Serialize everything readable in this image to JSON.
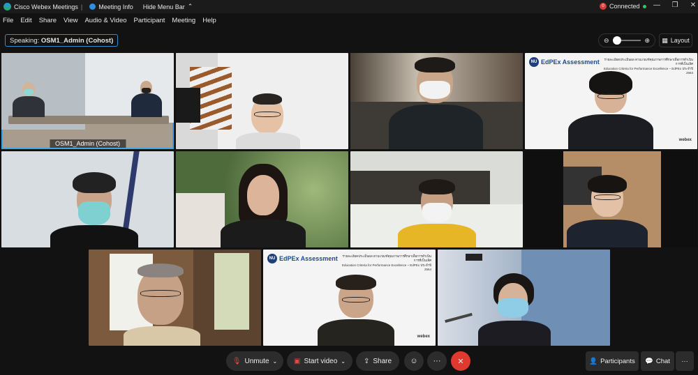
{
  "titlebar": {
    "app_title": "Cisco Webex Meetings",
    "separator": "|",
    "meeting_info": "Meeting Info",
    "hide_menu_bar": "Hide Menu Bar",
    "status_count": "0",
    "status": "Connected",
    "status_color": "#35c46a"
  },
  "menu": [
    "File",
    "Edit",
    "Share",
    "View",
    "Audio & Video",
    "Participant",
    "Meeting",
    "Help"
  ],
  "speaking": {
    "prefix": "Speaking:",
    "name": "OSM1_Admin (Cohost)"
  },
  "layout_button": "Layout",
  "zoom": {
    "level_fraction": 0.0
  },
  "tiles": [
    {
      "id": "osm1",
      "label": "OSM1_Admin  (Cohost)",
      "active": true
    },
    {
      "id": "p2"
    },
    {
      "id": "p3"
    },
    {
      "id": "p4",
      "brand": "EdPEx Assessment",
      "logo": "NU",
      "note_line1": "รายละเอียดประเมินผล ตามเกณฑ์คุณภาพการศึกษาเพื่อการดำเนินการที่เป็นเลิศ",
      "note_line2": "Education Criteria for Performance Excellence – EdPEx ประจำปี 2564",
      "webex": "webex"
    },
    {
      "id": "p5"
    },
    {
      "id": "p6"
    },
    {
      "id": "p7"
    },
    {
      "id": "p8"
    },
    {
      "id": "p9"
    },
    {
      "id": "p10",
      "brand": "EdPEx Assessment",
      "logo": "NU",
      "note_line1": "รายละเอียดประเมินผล ตามเกณฑ์คุณภาพการศึกษาเพื่อการดำเนินการที่เป็นเลิศ",
      "note_line2": "Education Criteria for Performance Excellence – EdPEx ประจำปี 2564",
      "webex": "webex"
    },
    {
      "id": "p11"
    }
  ],
  "toolbar": {
    "unmute": "Unmute",
    "start_video": "Start video",
    "share": "Share",
    "more": "···",
    "end_color": "#e03a30"
  },
  "right_panel": {
    "participants": "Participants",
    "chat": "Chat",
    "more": "···"
  }
}
